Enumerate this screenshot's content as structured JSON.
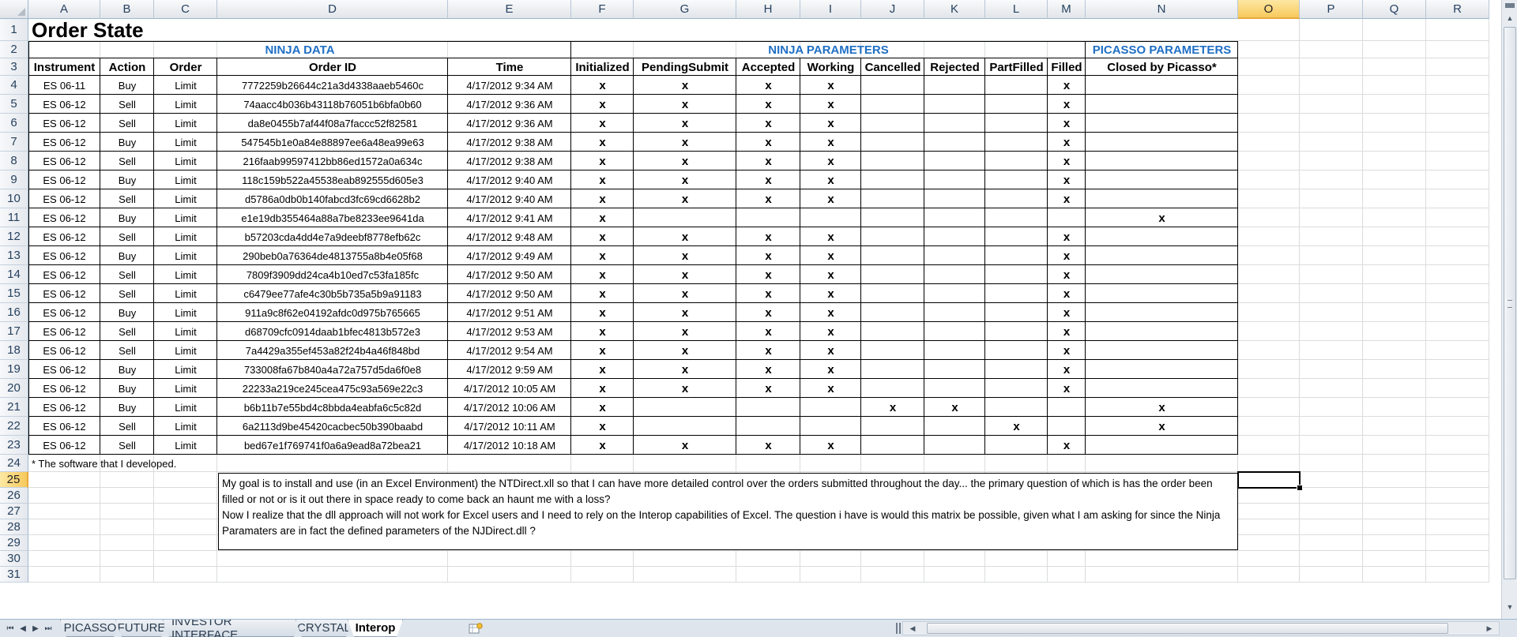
{
  "columns": [
    "A",
    "B",
    "C",
    "D",
    "E",
    "F",
    "G",
    "H",
    "I",
    "J",
    "K",
    "L",
    "M",
    "N",
    "O",
    "P",
    "Q",
    "R"
  ],
  "selected_column": "O",
  "rows": [
    "1",
    "2",
    "3",
    "4",
    "5",
    "6",
    "7",
    "8",
    "9",
    "10",
    "11",
    "12",
    "13",
    "14",
    "15",
    "16",
    "17",
    "18",
    "19",
    "20",
    "21",
    "22",
    "23",
    "24",
    "25",
    "26",
    "27",
    "28",
    "29",
    "30",
    "31"
  ],
  "selected_row": "25",
  "sheet": {
    "title": "Order State",
    "sections": {
      "ninja_data": "NINJA DATA",
      "ninja_parameters": "NINJA PARAMETERS",
      "picasso_parameters": "PICASSO PARAMETERS"
    },
    "headers": [
      "Instrument",
      "Action",
      "Order",
      "Order ID",
      "Time",
      "Initialized",
      "PendingSubmit",
      "Accepted",
      "Working",
      "Cancelled",
      "Rejected",
      "PartFilled",
      "Filled",
      "Closed by Picasso*"
    ],
    "mark": "x",
    "orders": [
      {
        "instrument": "ES 06-11",
        "action": "Buy",
        "order": "Limit",
        "id": "7772259b26644c21a3d4338aaeb5460c",
        "time": "4/17/2012 9:34 AM",
        "flags": [
          1,
          1,
          1,
          1,
          0,
          0,
          0,
          1,
          0
        ]
      },
      {
        "instrument": "ES 06-12",
        "action": "Sell",
        "order": "Limit",
        "id": "74aacc4b036b43118b76051b6bfa0b60",
        "time": "4/17/2012 9:36 AM",
        "flags": [
          1,
          1,
          1,
          1,
          0,
          0,
          0,
          1,
          0
        ]
      },
      {
        "instrument": "ES 06-12",
        "action": "Sell",
        "order": "Limit",
        "id": "da8e0455b7af44f08a7faccc52f82581",
        "time": "4/17/2012 9:36 AM",
        "flags": [
          1,
          1,
          1,
          1,
          0,
          0,
          0,
          1,
          0
        ]
      },
      {
        "instrument": "ES 06-12",
        "action": "Buy",
        "order": "Limit",
        "id": "547545b1e0a84e88897ee6a48ea99e63",
        "time": "4/17/2012 9:38 AM",
        "flags": [
          1,
          1,
          1,
          1,
          0,
          0,
          0,
          1,
          0
        ]
      },
      {
        "instrument": "ES 06-12",
        "action": "Sell",
        "order": "Limit",
        "id": "216faab99597412bb86ed1572a0a634c",
        "time": "4/17/2012 9:38 AM",
        "flags": [
          1,
          1,
          1,
          1,
          0,
          0,
          0,
          1,
          0
        ]
      },
      {
        "instrument": "ES 06-12",
        "action": "Buy",
        "order": "Limit",
        "id": "118c159b522a45538eab892555d605e3",
        "time": "4/17/2012 9:40 AM",
        "flags": [
          1,
          1,
          1,
          1,
          0,
          0,
          0,
          1,
          0
        ]
      },
      {
        "instrument": "ES 06-12",
        "action": "Sell",
        "order": "Limit",
        "id": "d5786a0db0b140fabcd3fc69cd6628b2",
        "time": "4/17/2012 9:40 AM",
        "flags": [
          1,
          1,
          1,
          1,
          0,
          0,
          0,
          1,
          0
        ]
      },
      {
        "instrument": "ES 06-12",
        "action": "Buy",
        "order": "Limit",
        "id": "e1e19db355464a88a7be8233ee9641da",
        "time": "4/17/2012 9:41 AM",
        "flags": [
          1,
          0,
          0,
          0,
          0,
          0,
          0,
          0,
          1
        ]
      },
      {
        "instrument": "ES 06-12",
        "action": "Sell",
        "order": "Limit",
        "id": "b57203cda4dd4e7a9deebf8778efb62c",
        "time": "4/17/2012 9:48 AM",
        "flags": [
          1,
          1,
          1,
          1,
          0,
          0,
          0,
          1,
          0
        ]
      },
      {
        "instrument": "ES 06-12",
        "action": "Buy",
        "order": "Limit",
        "id": "290beb0a76364de4813755a8b4e05f68",
        "time": "4/17/2012 9:49 AM",
        "flags": [
          1,
          1,
          1,
          1,
          0,
          0,
          0,
          1,
          0
        ]
      },
      {
        "instrument": "ES 06-12",
        "action": "Sell",
        "order": "Limit",
        "id": "7809f3909dd24ca4b10ed7c53fa185fc",
        "time": "4/17/2012 9:50 AM",
        "flags": [
          1,
          1,
          1,
          1,
          0,
          0,
          0,
          1,
          0
        ]
      },
      {
        "instrument": "ES 06-12",
        "action": "Sell",
        "order": "Limit",
        "id": "c6479ee77afe4c30b5b735a5b9a91183",
        "time": "4/17/2012 9:50 AM",
        "flags": [
          1,
          1,
          1,
          1,
          0,
          0,
          0,
          1,
          0
        ]
      },
      {
        "instrument": "ES 06-12",
        "action": "Buy",
        "order": "Limit",
        "id": "911a9c8f62e04192afdc0d975b765665",
        "time": "4/17/2012 9:51 AM",
        "flags": [
          1,
          1,
          1,
          1,
          0,
          0,
          0,
          1,
          0
        ]
      },
      {
        "instrument": "ES 06-12",
        "action": "Sell",
        "order": "Limit",
        "id": "d68709cfc0914daab1bfec4813b572e3",
        "time": "4/17/2012 9:53 AM",
        "flags": [
          1,
          1,
          1,
          1,
          0,
          0,
          0,
          1,
          0
        ]
      },
      {
        "instrument": "ES 06-12",
        "action": "Sell",
        "order": "Limit",
        "id": "7a4429a355ef453a82f24b4a46f848bd",
        "time": "4/17/2012 9:54 AM",
        "flags": [
          1,
          1,
          1,
          1,
          0,
          0,
          0,
          1,
          0
        ]
      },
      {
        "instrument": "ES 06-12",
        "action": "Buy",
        "order": "Limit",
        "id": "733008fa67b840a4a72a757d5da6f0e8",
        "time": "4/17/2012 9:59 AM",
        "flags": [
          1,
          1,
          1,
          1,
          0,
          0,
          0,
          1,
          0
        ]
      },
      {
        "instrument": "ES 06-12",
        "action": "Buy",
        "order": "Limit",
        "id": "22233a219ce245cea475c93a569e22c3",
        "time": "4/17/2012 10:05 AM",
        "flags": [
          1,
          1,
          1,
          1,
          0,
          0,
          0,
          1,
          0
        ]
      },
      {
        "instrument": "ES 06-12",
        "action": "Buy",
        "order": "Limit",
        "id": "b6b11b7e55bd4c8bbda4eabfa6c5c82d",
        "time": "4/17/2012 10:06 AM",
        "flags": [
          1,
          0,
          0,
          0,
          1,
          1,
          0,
          0,
          1
        ]
      },
      {
        "instrument": "ES 06-12",
        "action": "Sell",
        "order": "Limit",
        "id": "6a2113d9be45420cacbec50b390baabd",
        "time": "4/17/2012 10:11 AM",
        "flags": [
          1,
          0,
          0,
          0,
          0,
          0,
          1,
          0,
          1
        ]
      },
      {
        "instrument": "ES 06-12",
        "action": "Sell",
        "order": "Limit",
        "id": "bed67e1f769741f0a6a9ead8a72bea21",
        "time": "4/17/2012 10:18 AM",
        "flags": [
          1,
          1,
          1,
          1,
          0,
          0,
          0,
          1,
          0
        ]
      }
    ],
    "footnote": "* The software that I developed.",
    "textbox": {
      "p1": "My goal is to install and use (in an Excel Environment) the NTDirect.xll so that I can have more detailed control over the orders submitted throughout the day... the primary question of which is has the order been filled or not or is it out there in space ready to come back an haunt me with a loss?",
      "p2": "Now I realize that the dll approach will not work for Excel users and I need to rely on the Interop capabilities of Excel. The question i have is would this matrix be possible, given what I am asking for since the Ninja Paramaters are in fact the defined parameters of the NJDirect.dll ?"
    }
  },
  "tabs": [
    {
      "label": "PICASSO",
      "active": false
    },
    {
      "label": "FUTURE",
      "active": false
    },
    {
      "label": "INVESTOR INTERFACE",
      "active": false
    },
    {
      "label": "CRYSTAL",
      "active": false
    },
    {
      "label": "Interop",
      "active": true
    }
  ],
  "icons": {
    "tab_nav": [
      "first-sheet-icon",
      "prev-sheet-icon",
      "next-sheet-icon",
      "last-sheet-icon"
    ],
    "new_sheet": "insert-worksheet-icon"
  },
  "colors": {
    "section_header": "#1f6fc5",
    "selection": "#f7c95c"
  }
}
